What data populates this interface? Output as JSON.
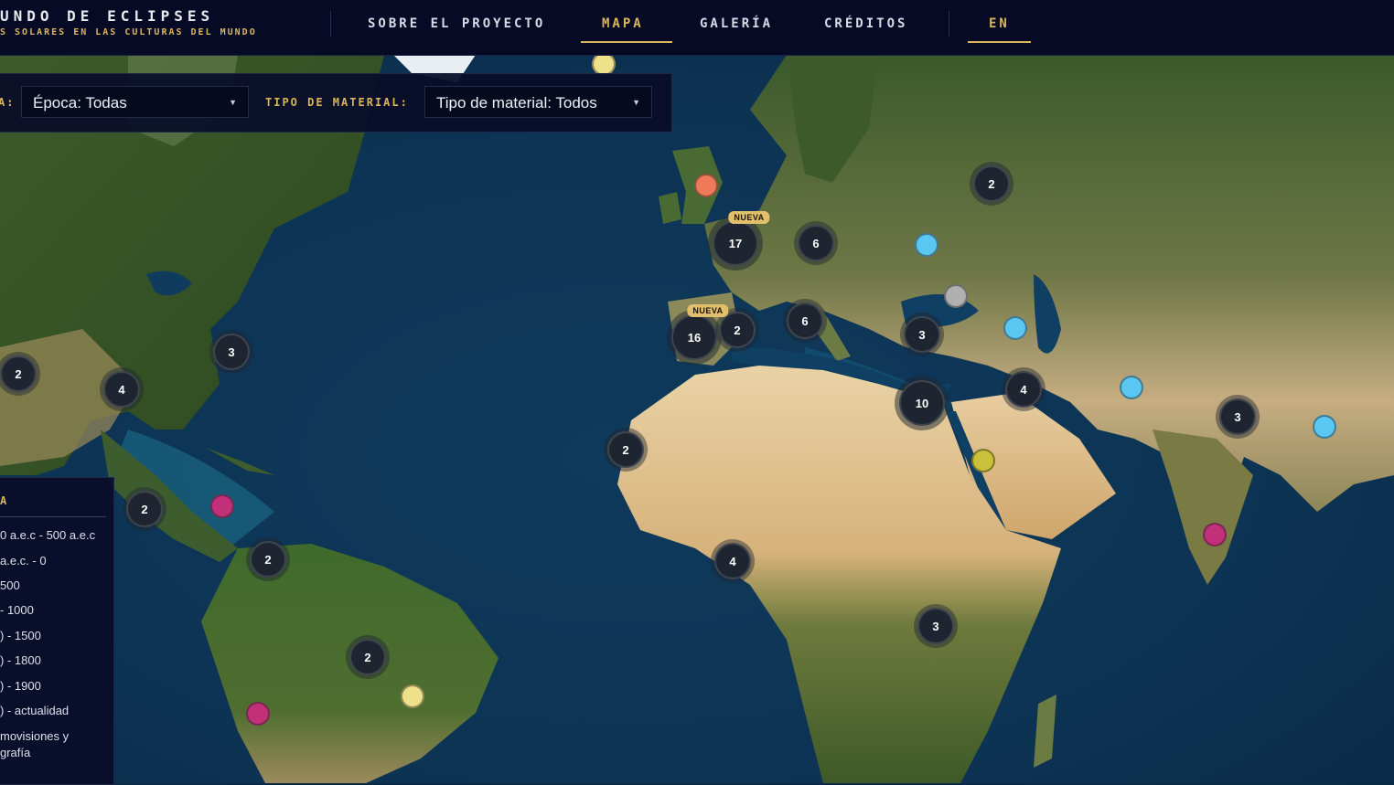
{
  "header": {
    "title": "UNDO DE ECLIPSES",
    "subtitle": "S SOLARES EN LAS CULTURAS DEL MUNDO",
    "nav": {
      "about": "SOBRE EL PROYECTO",
      "map": "MAPA",
      "gallery": "GALERÍA",
      "credits": "CRÉDITOS",
      "lang": "EN"
    }
  },
  "filters": {
    "epoch_label": "A:",
    "epoch_value": "Época: Todas",
    "material_label": "TIPO DE MATERIAL:",
    "material_value": "Tipo de material: Todos"
  },
  "legend": {
    "title": "A",
    "items": [
      "0 a.e.c - 500 a.e.c",
      "a.e.c. - 0",
      "500",
      "- 1000",
      ") - 1500",
      ") - 1800",
      ") - 1900",
      ") - actualidad",
      "movisiones y",
      "grafía"
    ]
  },
  "map": {
    "clusters": [
      {
        "count": "2"
      },
      {
        "count": "17"
      },
      {
        "count": "6"
      },
      {
        "count": "16"
      },
      {
        "count": "2"
      },
      {
        "count": "6"
      },
      {
        "count": "3"
      },
      {
        "count": "10"
      },
      {
        "count": "4"
      },
      {
        "count": "3"
      },
      {
        "count": "3"
      },
      {
        "count": "2"
      },
      {
        "count": "4"
      },
      {
        "count": "2"
      },
      {
        "count": "2"
      },
      {
        "count": "2"
      },
      {
        "count": "4"
      },
      {
        "count": "3"
      },
      {
        "count": "2"
      }
    ],
    "badge_new": "NUEVA",
    "colors": {
      "accent": "#d9b65a",
      "orange": "#ef7a5a",
      "sky": "#5ac7f2",
      "grey": "#b0b0b0",
      "olive": "#c9c13a",
      "magenta": "#c2307a",
      "pale_yellow": "#efe08a"
    }
  }
}
